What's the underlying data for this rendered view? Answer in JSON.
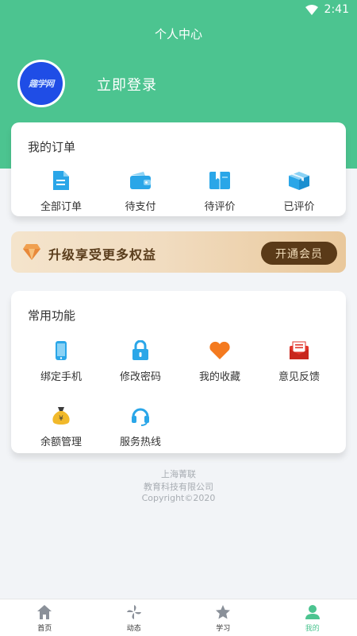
{
  "status_bar": {
    "time": "2:41"
  },
  "header": {
    "title": "个人中心",
    "avatar_text": "趣学网",
    "login_label": "立即登录"
  },
  "orders": {
    "title": "我的订单",
    "items": [
      {
        "label": "全部订单",
        "icon": "document-icon"
      },
      {
        "label": "待支付",
        "icon": "wallet-icon"
      },
      {
        "label": "待评价",
        "icon": "book-icon"
      },
      {
        "label": "已评价",
        "icon": "package-icon"
      }
    ]
  },
  "vip": {
    "text": "升级享受更多权益",
    "button": "开通会员"
  },
  "functions": {
    "title": "常用功能",
    "items": [
      {
        "label": "绑定手机",
        "icon": "phone-icon"
      },
      {
        "label": "修改密码",
        "icon": "lock-icon"
      },
      {
        "label": "我的收藏",
        "icon": "heart-icon"
      },
      {
        "label": "意见反馈",
        "icon": "mail-icon"
      },
      {
        "label": "余额管理",
        "icon": "money-bag-icon"
      },
      {
        "label": "服务热线",
        "icon": "headset-icon"
      }
    ]
  },
  "footer": {
    "line1": "上海菁联",
    "line2": "教育科技有限公司",
    "line3": "Copyright©2020"
  },
  "tabs": [
    {
      "label": "首页",
      "icon": "home-icon"
    },
    {
      "label": "动态",
      "icon": "pinwheel-icon"
    },
    {
      "label": "学习",
      "icon": "star-icon"
    },
    {
      "label": "我的",
      "icon": "user-icon"
    }
  ],
  "colors": {
    "brand": "#4cc490",
    "vip_button": "#5a3a18",
    "icon_blue": "#2aa6e8"
  }
}
